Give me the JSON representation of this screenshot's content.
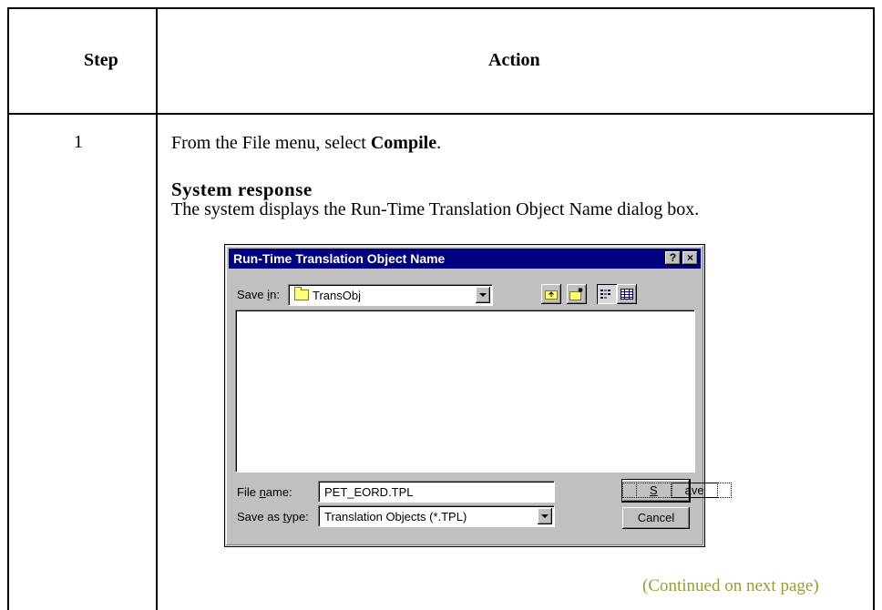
{
  "table": {
    "header_step": "Step",
    "header_action": "Action",
    "step_number": "1",
    "instruction_prefix": "From the File menu, select ",
    "instruction_bold": "Compile",
    "instruction_suffix": ".",
    "system_response_title": "System response",
    "system_response_text": "The system displays the Run-Time Translation Object Name dialog box.",
    "continued": "(Continued on next page)"
  },
  "dialog": {
    "title": "Run-Time Translation Object Name",
    "help_btn": "?",
    "close_btn": "×",
    "save_in_label_pre": "Save ",
    "save_in_label_u": "i",
    "save_in_label_post": "n:",
    "save_in_value": "TransObj",
    "file_name_label_pre": "File ",
    "file_name_label_u": "n",
    "file_name_label_post": "ame:",
    "file_name_value": "PET_EORD.TPL",
    "save_type_label_pre": "Save as ",
    "save_type_label_u": "t",
    "save_type_label_post": "ype:",
    "save_type_value": "Translation Objects (*.TPL)",
    "save_btn_u": "S",
    "save_btn_rest": "ave",
    "cancel_btn": "Cancel"
  },
  "icons": [
    "up-folder-icon",
    "new-folder-icon",
    "list-view-icon",
    "details-view-icon",
    "folder-icon",
    "chevron-down-icon"
  ]
}
